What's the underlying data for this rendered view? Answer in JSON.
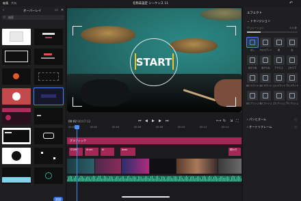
{
  "topbar": {
    "tab_edit": "編集",
    "tab_share": "共有",
    "title": "名称未設定 シーケンス 11",
    "undo_icon": "undo-icon"
  },
  "left_panel": {
    "back": "‹",
    "title": "オーバーレイ",
    "search_placeholder": "検索",
    "fab_label": "追加"
  },
  "preview": {
    "overlay_text": "START",
    "accent": "#f3c51b"
  },
  "controls": {
    "timecode": "00:02",
    "timecode_frames": "00:07:12",
    "zoom_icon": "zoom-icon",
    "fit_icon": "fit-icon"
  },
  "timeline": {
    "ruler": [
      "00:00",
      "00:02",
      "00:04",
      "00:06",
      "00:08",
      "00:10",
      "00:12",
      "00:14"
    ],
    "graphic_track_label": "グラフィック",
    "clips": [
      "START",
      "drum",
      "dr",
      "bass",
      "終わり"
    ]
  },
  "right_panel": {
    "title": "エフェクト",
    "section_transition": "トランジション",
    "duration_label": "デュレーション",
    "duration_value": "0.5 秒",
    "transitions": [
      "なし",
      "クロスディゾルブ",
      "黒",
      "白",
      "左から右",
      "右から左",
      "下から上",
      "上から下",
      "右にスライド",
      "左にスライド",
      "上にスライド",
      "下にスライド",
      "左にプッシュ",
      "右にプッシュ",
      "上にプッシュ",
      "下にプッシュ"
    ],
    "section_pan_zoom": "パンとズーム",
    "section_autoframe": "オートリフレーム"
  }
}
